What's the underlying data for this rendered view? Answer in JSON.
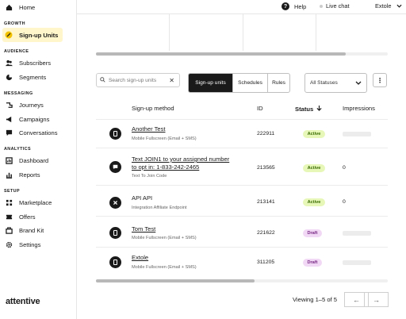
{
  "sidebar": {
    "home": "Home",
    "sections": [
      "GROWTH",
      "AUDIENCE",
      "MESSAGING",
      "ANALYTICS",
      "SETUP"
    ],
    "growth": [
      "Sign-up Units"
    ],
    "audience": [
      "Subscribers",
      "Segments"
    ],
    "messaging": [
      "Journeys",
      "Campaigns",
      "Conversations"
    ],
    "analytics": [
      "Dashboard",
      "Reports"
    ],
    "setup": [
      "Marketplace",
      "Offers",
      "Brand Kit",
      "Settings"
    ],
    "logo": "attentive"
  },
  "topbar": {
    "help": "Help",
    "live_chat": "Live chat",
    "account": "Extole"
  },
  "toolbar": {
    "search_placeholder": "Search sign-up units",
    "tabs": [
      "Sign-up units",
      "Schedules",
      "Rules"
    ],
    "status_filter": "All Statuses",
    "more": "⋮"
  },
  "table": {
    "headers": {
      "method": "Sign-up method",
      "id": "ID",
      "status": "Status",
      "impressions": "Impressions"
    },
    "rows": [
      {
        "title": "Another Test",
        "subtitle": "Mobile Fullscreen (Email + SMS)",
        "id": "222911",
        "status": "Active",
        "impressions": ""
      },
      {
        "title1": "Text JOIN1 to your assigned number",
        "title2": "to opt in: 1-833-242-2465",
        "subtitle": "Text To Join Code",
        "id": "213565",
        "status": "Active",
        "impressions": "0"
      },
      {
        "title": "API API",
        "subtitle": "Integration Affiliate Endpoint",
        "id": "213141",
        "status": "Active",
        "impressions": "0"
      },
      {
        "title": "Tom Test",
        "subtitle": "Mobile Fullscreen (Email + SMS)",
        "id": "221622",
        "status": "Draft",
        "impressions": ""
      },
      {
        "title": "Extole",
        "subtitle": "Mobile Fullscreen (Email + SMS)",
        "id": "311205",
        "status": "Draft",
        "impressions": ""
      }
    ]
  },
  "pagination": {
    "text": "Viewing 1–5 of 5",
    "prev": "←",
    "next": "→"
  },
  "colors": {
    "active_badge": "#e6f7b8",
    "draft_badge": "#f1d9f5",
    "selected_nav": "#fff6cc"
  }
}
